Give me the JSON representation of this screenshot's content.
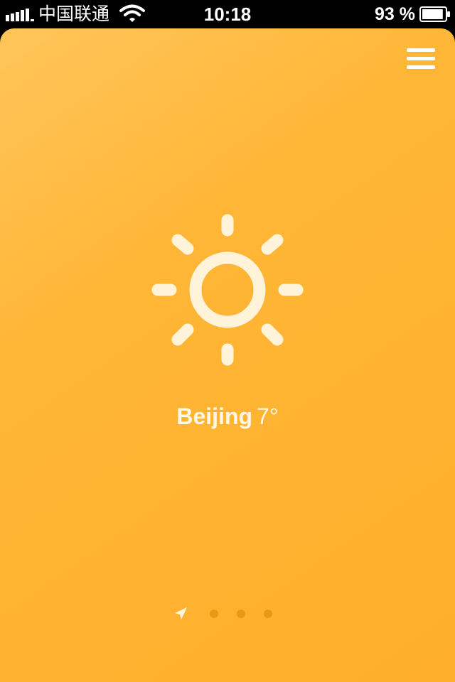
{
  "status_bar": {
    "carrier": "中国联通",
    "time": "10:18",
    "battery_percent": "93 %",
    "battery_level": 0.93
  },
  "weather": {
    "city": "Beijing",
    "temperature": "7°",
    "condition_icon": "sun-icon"
  },
  "menu": {
    "icon": "hamburger-menu-icon"
  },
  "pager": {
    "current_icon": "location-arrow-icon",
    "page_count": 4,
    "current_index": 0
  },
  "colors": {
    "card_top": "#ffc55a",
    "card_bottom": "#ffaf2a",
    "icon_color": "#fff3d9",
    "dot_color": "#e89a14"
  }
}
